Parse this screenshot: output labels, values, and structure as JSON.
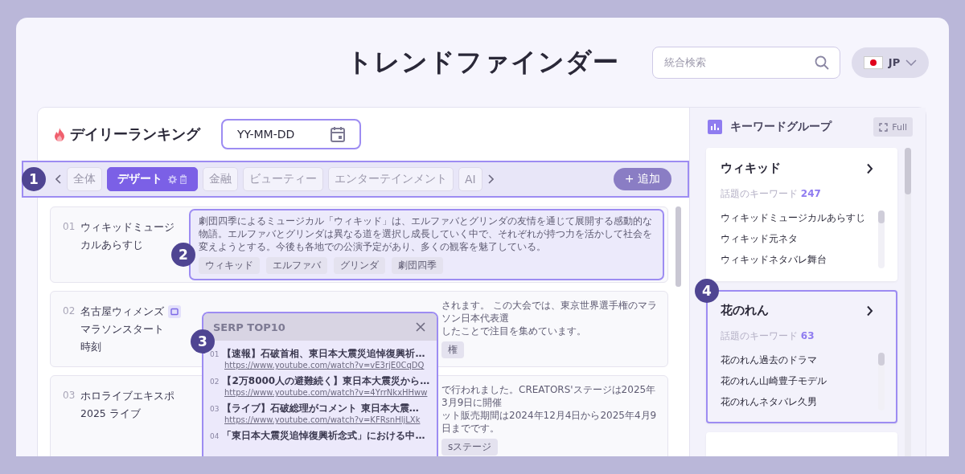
{
  "title": "トレンドファインダー",
  "search": {
    "placeholder": "統合検索"
  },
  "language": {
    "label": "JP"
  },
  "ranking": {
    "title": "デイリーランキング",
    "date": {
      "placeholder": "YY-MM-DD"
    }
  },
  "category_bar": {
    "marker": "1",
    "add_button": "+ 追加",
    "tabs": [
      {
        "label": "全体",
        "selected": false
      },
      {
        "label": "デザート",
        "selected": true
      },
      {
        "label": "金融",
        "selected": false
      },
      {
        "label": "ビューティー",
        "selected": false
      },
      {
        "label": "エンターテインメント",
        "selected": false
      },
      {
        "label": "AI",
        "selected": false
      }
    ]
  },
  "rows": [
    {
      "rank": "01",
      "title": "ウィキッドミュージカルあらすじ",
      "marker": "2",
      "description_lines": [
        "劇団四季によるミュージカル「ウィキッド」は、エルファバとグリンダの友情を通じて展開する感動的な物語。エルファバとグリンダは異なる道を選択し成長していく中で、それぞれが持つ力を活かして社会を変えようとする。今後も各地での公演予定があり、多くの観客を魅了している。"
      ],
      "tags": [
        "ウィキッド",
        "エルファバ",
        "グリンダ",
        "劇団四季"
      ]
    },
    {
      "rank": "02",
      "title": "名古屋ウィメンズマラソンスタート時刻",
      "description_lines": [
        "されます。 この大会では、東京世界選手権のマラソン日本代表選",
        "したことで注目を集めています。"
      ],
      "tags": [
        "権"
      ]
    },
    {
      "rank": "03",
      "title": "ホロライブエキスポ2025 ライブ",
      "description_lines": [
        "で行われました。CREATORS'ステージは2025年3月9日に開催",
        "ット販売期間は2024年12月4日から2025年4月9日までです。"
      ],
      "tags": [
        "sステージ"
      ]
    }
  ],
  "serp": {
    "title": "SERP TOP10",
    "marker": "3",
    "items": [
      {
        "rank": "01",
        "title": "【速報】石破首相、東日本大震災追悼復興祈…",
        "url": "https://www.youtube.com/watch?v=vE3rjE0CqDQ"
      },
      {
        "rank": "02",
        "title": "【2万8000人の避難続く】東日本大震災から…",
        "url": "https://www.youtube.com/watch?v=4YrrNkxHHww"
      },
      {
        "rank": "03",
        "title": "【ライブ】石破総理がコメント 東日本大震…",
        "url": "https://www.youtube.com/watch?v=KFRsnHljLXk"
      },
      {
        "rank": "04",
        "title": "「東日本大震災追悼復興祈念式」における中…"
      }
    ]
  },
  "keyword_groups": {
    "title": "キーワードグループ",
    "full_button": "Full",
    "groups": [
      {
        "name": "ウィキッド",
        "label": "話題のキーワード",
        "count": "247",
        "keywords": [
          "ウィキッドミュージカルあらすじ",
          "ウィキッド元ネタ",
          "ウィキッドネタバレ舞台"
        ]
      },
      {
        "name": "花のれん",
        "label": "話題のキーワード",
        "count": "63",
        "marker": "4",
        "keywords": [
          "花のれん過去のドラマ",
          "花のれん山崎豊子モデル",
          "花のれんネタバレ久男"
        ]
      }
    ]
  }
}
